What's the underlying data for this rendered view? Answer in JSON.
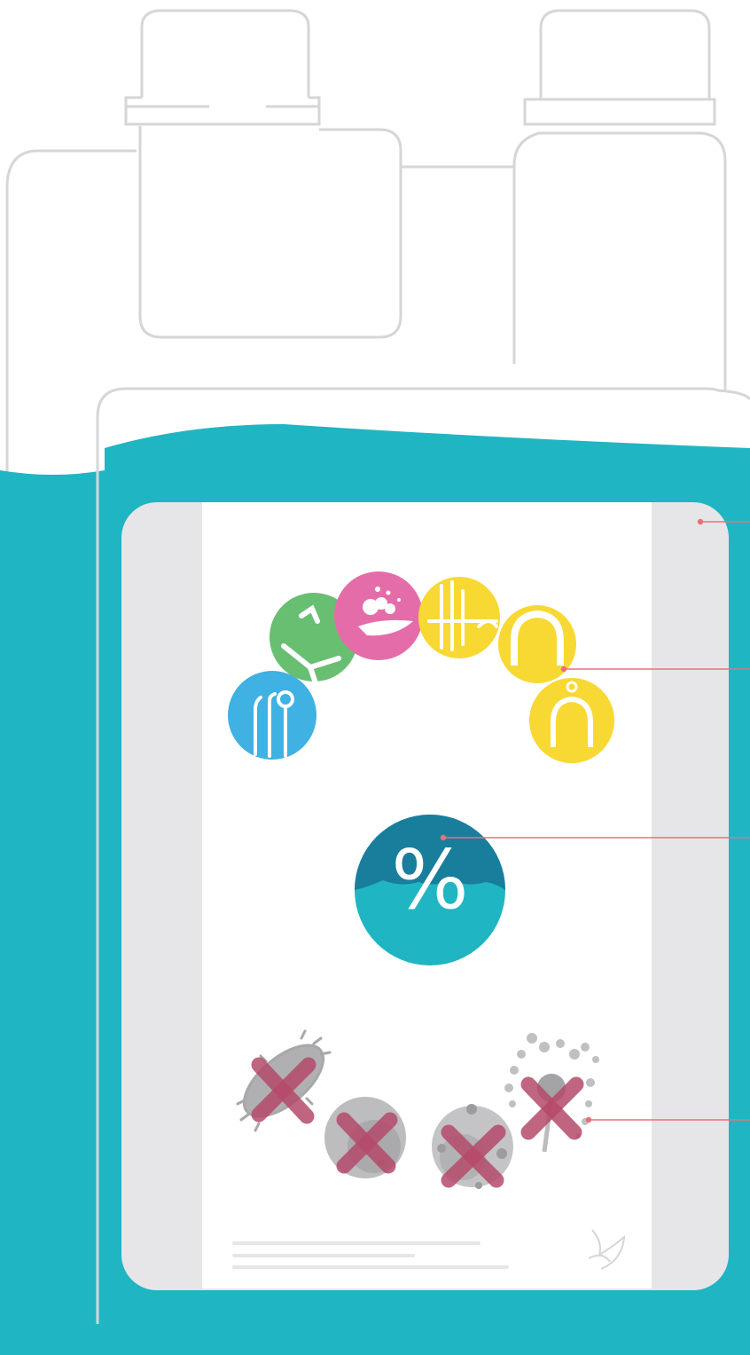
{
  "colors": {
    "outline": "#d6d6d8",
    "liquid": "#20b5c3",
    "liquid_dark": "#187e9c",
    "label_side": "#e6e6e8",
    "label_paper": "#ffffff",
    "callout": "#e8707a",
    "cross": "#b54a6a",
    "green": "#68bf72",
    "pink": "#e46da9",
    "yellow": "#f8d832",
    "blue": "#3fb1e3",
    "microbe_gray": "#a8a8aa"
  },
  "icons": {
    "dental_instruments": "dental-instruments-icon",
    "dental_chair": "dental-chair-icon",
    "hand_wash": "hand-wash-icon",
    "suction_tips": "suction-tips-icon",
    "dental_arch": "dental-arch-icon",
    "impression_tray": "impression-tray-icon"
  },
  "concentration": {
    "symbol": "%"
  },
  "microbes": [
    "bacteria-crossed",
    "virus-crossed",
    "spore-crossed",
    "fungus-crossed"
  ]
}
